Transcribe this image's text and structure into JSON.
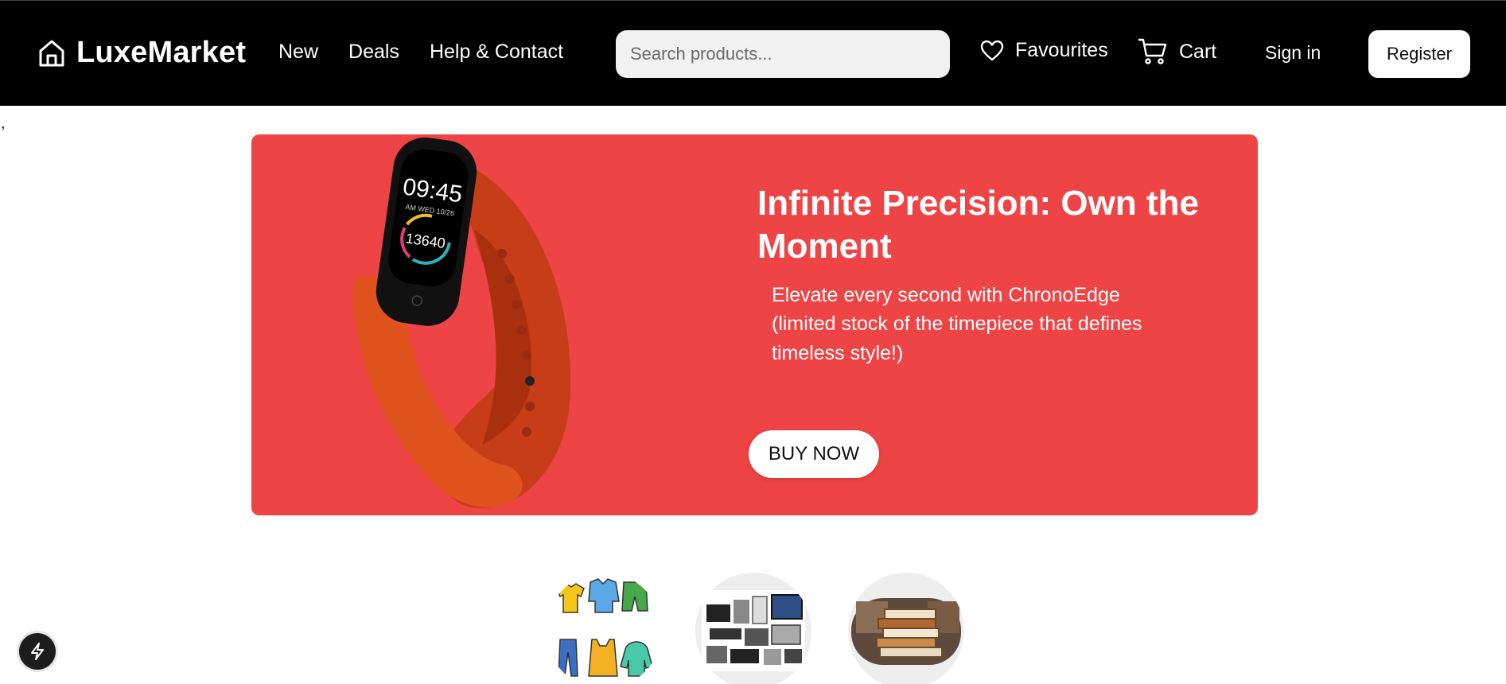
{
  "header": {
    "brand": "LuxeMarket",
    "nav": [
      "New",
      "Deals",
      "Help & Contact"
    ],
    "search_placeholder": "Search products...",
    "favourites_label": "Favourites",
    "cart_label": "Cart",
    "signin_label": "Sign in",
    "register_label": "Register"
  },
  "stray_text": ",",
  "hero": {
    "title": "Infinite Precision: Own the Moment",
    "description": "Elevate every second with ChronoEdge (limited stock of the timepiece that defines timeless style!)",
    "cta": "BUY NOW",
    "watch_time": "09:45",
    "watch_date": "AM WED 10/26",
    "watch_steps": "13640",
    "background_color": "#ef4446",
    "strap_color": "#d9481f"
  },
  "categories": [
    {
      "icon": "clothing-icon"
    },
    {
      "icon": "electronics-icon"
    },
    {
      "icon": "books-icon"
    }
  ],
  "icons": {
    "brand": "home-icon",
    "favourites": "heart-icon",
    "cart": "cart-icon",
    "dev_tool": "lightning-bolt-icon"
  }
}
